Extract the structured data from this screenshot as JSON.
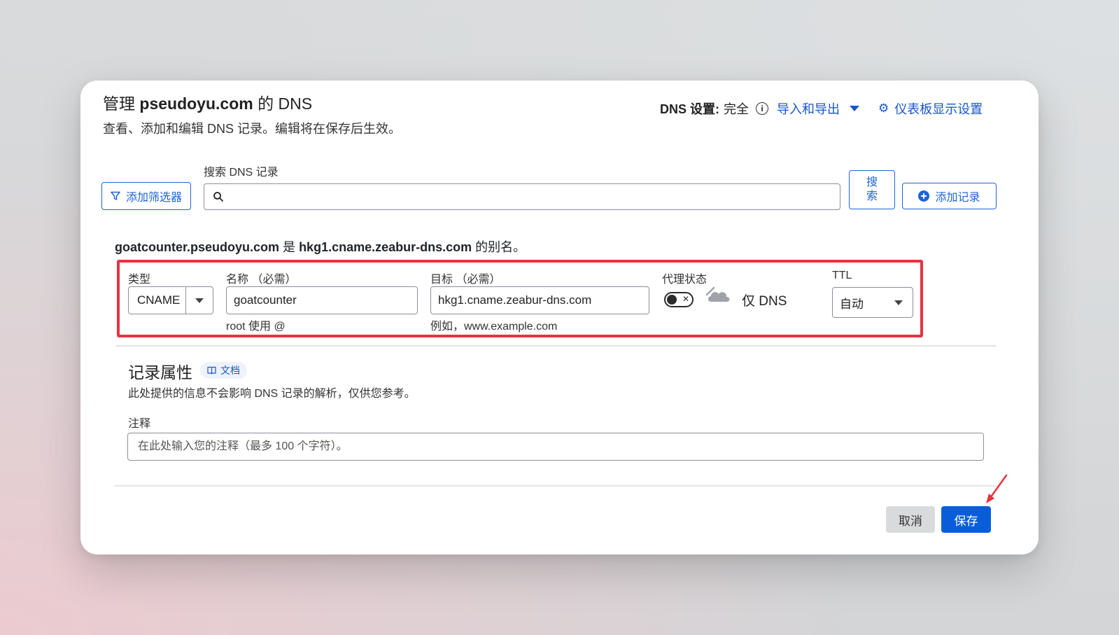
{
  "header": {
    "title_prefix": "管理",
    "domain": "pseudoyu.com",
    "title_suffix": "的 DNS",
    "subtitle": "查看、添加和编辑 DNS 记录。编辑将在保存后生效。",
    "dns_setting_key": "DNS 设置:",
    "dns_setting_value": "完全",
    "import_export": "导入和导出",
    "dashboard_settings": "仪表板显示设置"
  },
  "toolbar": {
    "add_filter": "添加筛选器",
    "search_label": "搜索 DNS 记录",
    "search_value": "",
    "search_button_line1": "搜",
    "search_button_line2": "索",
    "add_record": "添加记录"
  },
  "record": {
    "alias_name": "goatcounter.pseudoyu.com",
    "alias_is": "是",
    "alias_target": "hkg1.cname.zeabur-dns.com",
    "alias_suffix": "的别名。",
    "type_label": "类型",
    "type_value": "CNAME",
    "name_label": "名称 （必需）",
    "name_value": "goatcounter",
    "name_hint": "root 使用 @",
    "target_label": "目标 （必需）",
    "target_value": "hkg1.cname.zeabur-dns.com",
    "target_hint": "例如，www.example.com",
    "proxy_label": "代理状态",
    "proxy_text": "仅 DNS",
    "proxy_enabled": false,
    "ttl_label": "TTL",
    "ttl_value": "自动"
  },
  "attributes": {
    "title": "记录属性",
    "doc_badge": "文档",
    "description": "此处提供的信息不会影响 DNS 记录的解析，仅供您参考。",
    "comment_label": "注释",
    "comment_placeholder": "在此处输入您的注释（最多 100 个字符）。",
    "comment_value": ""
  },
  "actions": {
    "cancel": "取消",
    "save": "保存"
  },
  "colors": {
    "accent": "#1756c9",
    "save_button": "#0a5dd9",
    "highlight_box": "#e8323f",
    "annotation_arrow": "#e8323f"
  }
}
